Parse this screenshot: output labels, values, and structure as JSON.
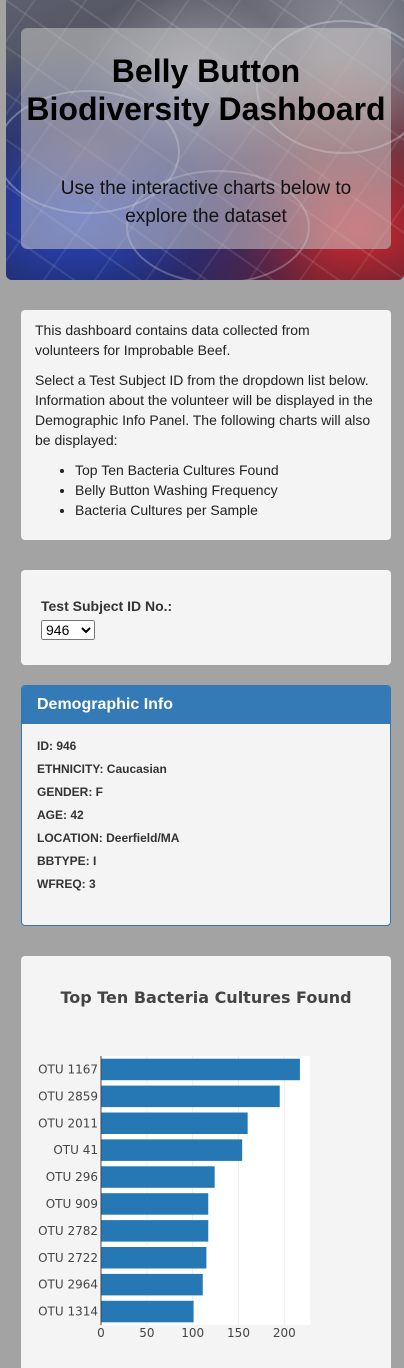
{
  "header": {
    "title": "Belly Button Biodiversity Dashboard",
    "subtitle": "Use the interactive charts below to explore the dataset"
  },
  "intro": {
    "paragraph1": "This dashboard contains data collected from volunteers for Improbable Beef.",
    "paragraph2": "Select a Test Subject ID from the dropdown list below. Information about the volunteer will be displayed in the Demographic Info Panel. The following charts will also be displayed:",
    "list": [
      "Top Ten Bacteria Cultures Found",
      "Belly Button Washing Frequency",
      "Bacteria Cultures per Sample"
    ]
  },
  "selector": {
    "label": "Test Subject ID No.:",
    "selected": "946"
  },
  "demographic": {
    "title": "Demographic Info",
    "rows": [
      "ID: 946",
      "ETHNICITY: Caucasian",
      "GENDER: F",
      "AGE: 42",
      "LOCATION: Deerfield/MA",
      "BBTYPE: I",
      "WFREQ: 3"
    ]
  },
  "chart_data": {
    "type": "bar",
    "orientation": "horizontal",
    "title": "Top Ten Bacteria Cultures Found",
    "categories": [
      "OTU 1167",
      "OTU 2859",
      "OTU 2011",
      "OTU 41",
      "OTU 296",
      "OTU 909",
      "OTU 2782",
      "OTU 2722",
      "OTU 2964",
      "OTU 1314"
    ],
    "values": [
      217,
      195,
      160,
      154,
      124,
      117,
      117,
      115,
      111,
      101
    ],
    "xticks": [
      0,
      50,
      100,
      150,
      200
    ],
    "xlim": [
      0,
      228
    ],
    "bar_color": "#2678b5",
    "grid": true
  }
}
